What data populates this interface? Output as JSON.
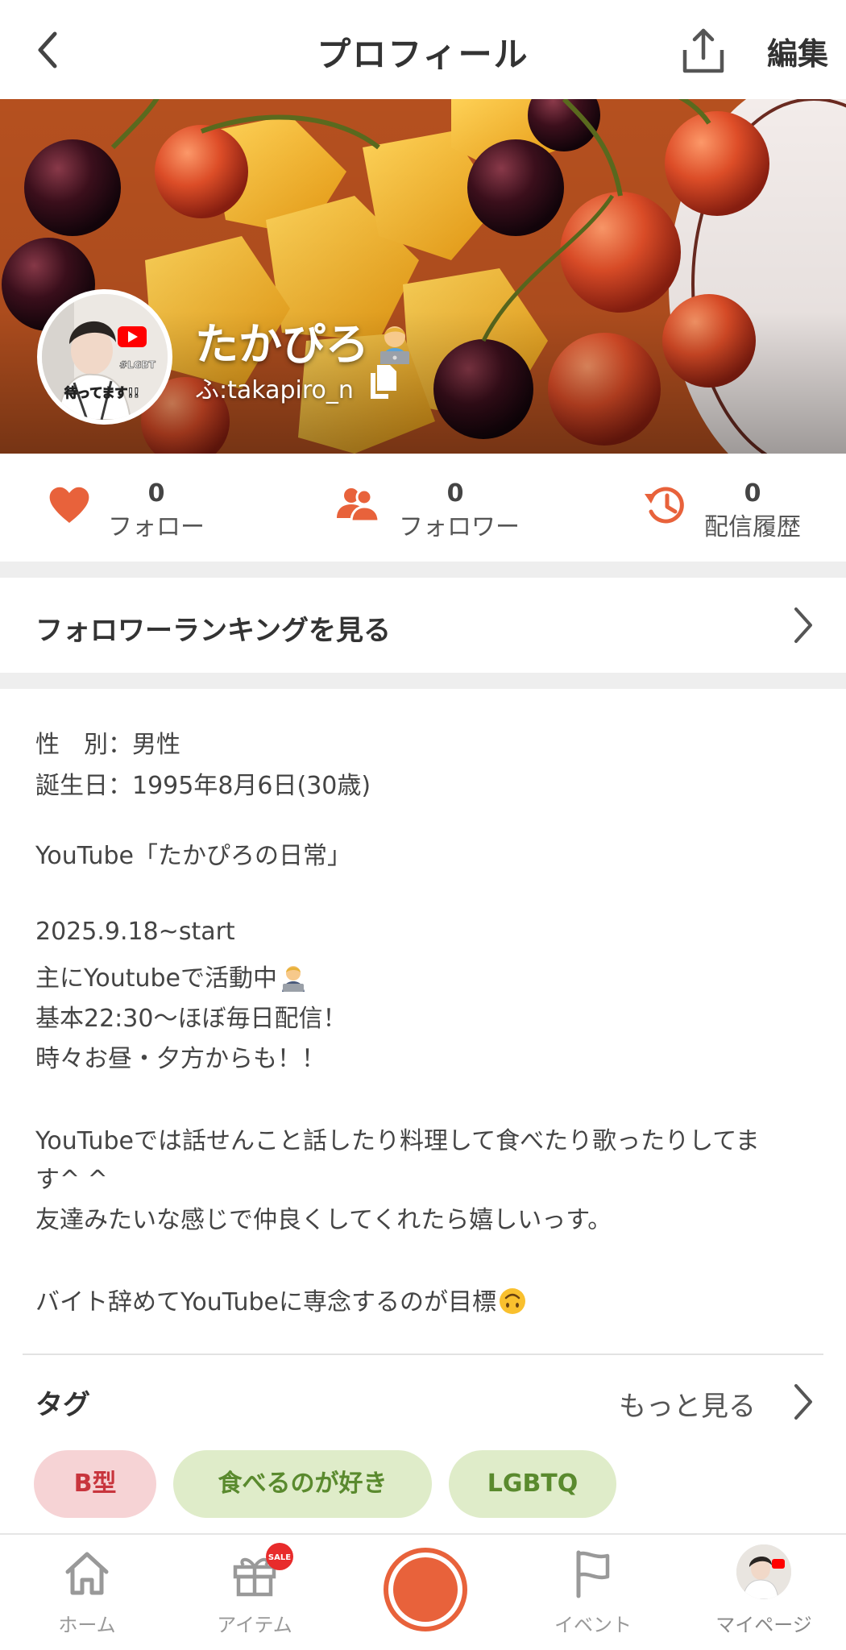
{
  "header": {
    "title": "プロフィール",
    "edit_label": "編集"
  },
  "profile": {
    "display_name": "たかぴろ",
    "user_id": "ふ:takapiro_n",
    "avatar_overlay_texts": [
      "#LGBT",
      "待ってます!!"
    ]
  },
  "stats": [
    {
      "count": "0",
      "label": "フォロー"
    },
    {
      "count": "0",
      "label": "フォロワー"
    },
    {
      "count": "0",
      "label": "配信履歴"
    }
  ],
  "ranking": {
    "label": "フォロワーランキングを見る"
  },
  "info": {
    "gender_line": "性　別：男性",
    "birthday_line": "誕生日：1995年8月6日(30歳)",
    "bio": [
      "YouTube「たかぴろの日常」",
      "2025.9.18~start",
      "主にYoutubeで活動中",
      "基本22:30〜ほぼ毎日配信！",
      "時々お昼・夕方からも！！",
      "YouTubeでは話せんこと話したり料理して食べたり歌ったりしてま",
      "す^ ^",
      "友達みたいな感じで仲良くしてくれたら嬉しいっす。",
      "バイト辞めてYouTubeに専念するのが目標"
    ]
  },
  "tags": {
    "title": "タグ",
    "more_label": "もっと見る",
    "items": [
      "B型",
      "食べるのが好き",
      "LGBTQ"
    ]
  },
  "bottom_nav": {
    "home": "ホーム",
    "items": "アイテム",
    "sale_badge": "SALE",
    "events": "イベント",
    "mypage": "マイページ"
  },
  "colors": {
    "accent": "#e8623b",
    "tag_blood_bg": "#f6d3d5",
    "tag_blood_fg": "#c8353d",
    "tag_green_bg": "#dfecc9",
    "tag_green_fg": "#5a8a2e"
  }
}
